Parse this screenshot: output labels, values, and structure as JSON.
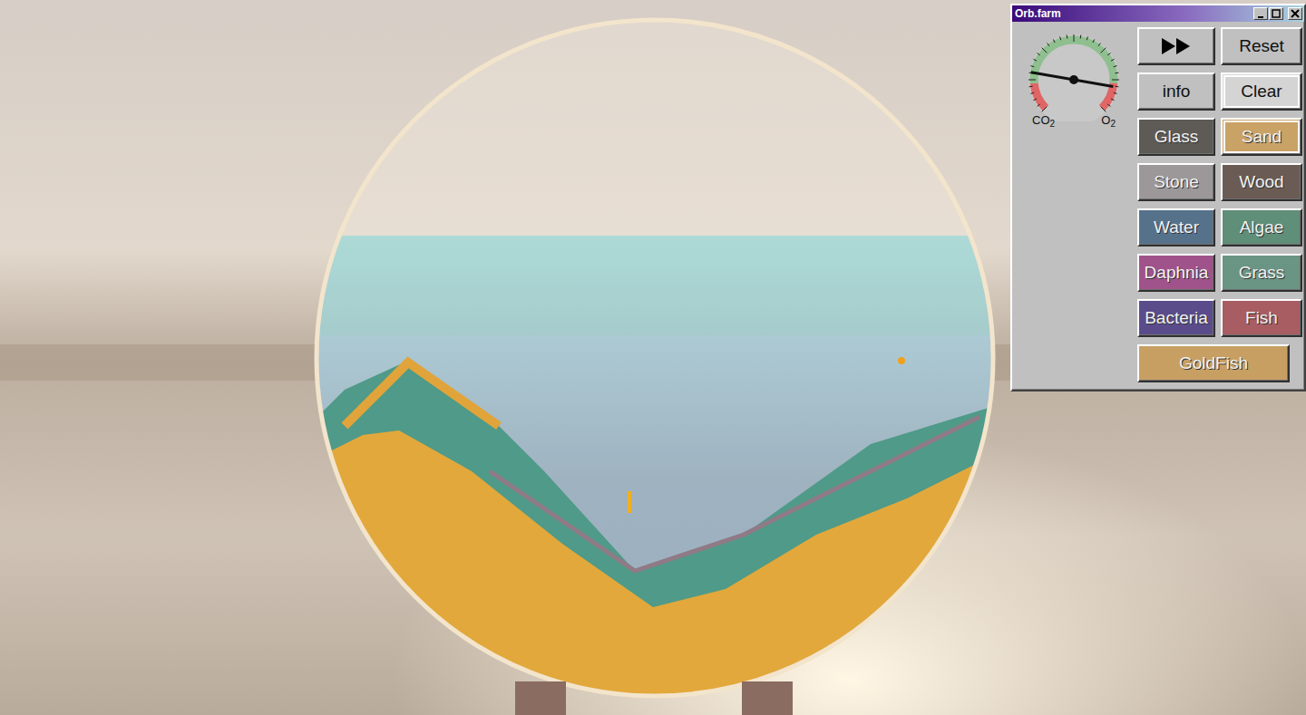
{
  "window": {
    "title": "Orb.farm"
  },
  "gauge": {
    "level": 0.87,
    "labels": [
      {
        "base": "CO",
        "sub": "2"
      },
      {
        "base": "O",
        "sub": "2"
      }
    ]
  },
  "buttons": [
    {
      "kind": "fast-forward",
      "label": "",
      "color": "#c0c0c0",
      "selected": false
    },
    {
      "kind": "action",
      "label": "Reset",
      "color": "#c0c0c0",
      "selected": false
    },
    {
      "kind": "action",
      "label": "info",
      "color": "#c0c0c0",
      "selected": false
    },
    {
      "kind": "action",
      "label": "Clear",
      "color": "#d4d4d4",
      "selected": true
    },
    {
      "kind": "tool",
      "label": "Glass",
      "color": "#5e5b56",
      "selected": false
    },
    {
      "kind": "tool",
      "label": "Sand",
      "color": "#c9a266",
      "selected": true
    },
    {
      "kind": "tool",
      "label": "Stone",
      "color": "#9c9899",
      "selected": false
    },
    {
      "kind": "tool",
      "label": "Wood",
      "color": "#6a5c54",
      "selected": false
    },
    {
      "kind": "tool",
      "label": "Water",
      "color": "#56728b",
      "selected": false
    },
    {
      "kind": "tool",
      "label": "Algae",
      "color": "#5f8e79",
      "selected": false
    },
    {
      "kind": "tool",
      "label": "Daphnia",
      "color": "#a0528a",
      "selected": false
    },
    {
      "kind": "tool",
      "label": "Grass",
      "color": "#6a9483",
      "selected": false
    },
    {
      "kind": "tool",
      "label": "Bacteria",
      "color": "#5a4c8a",
      "selected": false
    },
    {
      "kind": "tool",
      "label": "Fish",
      "color": "#a85d63",
      "selected": false
    },
    {
      "kind": "tool",
      "label": "GoldFish",
      "color": "#c79f63",
      "selected": false
    }
  ]
}
